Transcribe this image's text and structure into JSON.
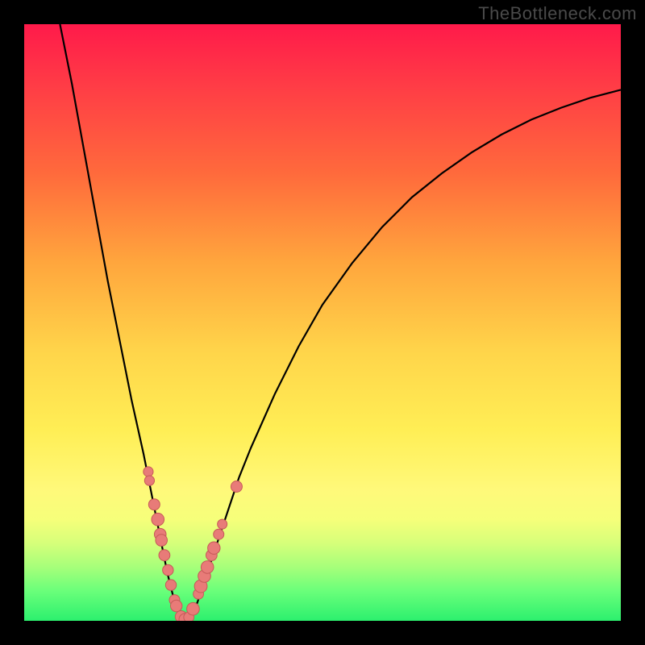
{
  "attribution": "TheBottleneck.com",
  "chart_data": {
    "type": "line",
    "title": "",
    "xlabel": "",
    "ylabel": "",
    "xlim": [
      0,
      100
    ],
    "ylim": [
      0,
      100
    ],
    "grid": false,
    "legend": false,
    "background": "rainbow_gradient_red_to_green",
    "series": [
      {
        "name": "bottleneck-curve",
        "type": "line",
        "color": "#000000",
        "x": [
          6,
          8,
          10,
          12,
          14,
          16,
          18,
          20,
          22,
          23,
          24,
          25,
          26,
          27,
          28,
          29,
          30,
          32,
          34,
          36,
          38,
          42,
          46,
          50,
          55,
          60,
          65,
          70,
          75,
          80,
          85,
          90,
          95,
          100
        ],
        "y": [
          100,
          90,
          79,
          68,
          57,
          47,
          37,
          28,
          18,
          13,
          8,
          4,
          1,
          0,
          1,
          3,
          6,
          12,
          18,
          24,
          29,
          38,
          46,
          53,
          60,
          66,
          71,
          75,
          78.5,
          81.5,
          84,
          86,
          87.7,
          89
        ]
      },
      {
        "name": "highlight-dots",
        "type": "scatter",
        "color": "#e87b78",
        "x": [
          20.8,
          21.0,
          21.8,
          22.4,
          22.8,
          23.0,
          23.5,
          24.1,
          24.6,
          25.2,
          25.5,
          26.3,
          27.0,
          27.6,
          28.3,
          29.2,
          29.6,
          30.2,
          30.7,
          31.4,
          31.8,
          32.6,
          33.2,
          35.6
        ],
        "y": [
          25,
          23.5,
          19.5,
          17,
          14.5,
          13.5,
          11,
          8.5,
          6,
          3.5,
          2.5,
          0.7,
          0.2,
          0.6,
          2.0,
          4.5,
          5.8,
          7.5,
          9,
          11,
          12.2,
          14.5,
          16.2,
          22.5
        ]
      }
    ]
  }
}
